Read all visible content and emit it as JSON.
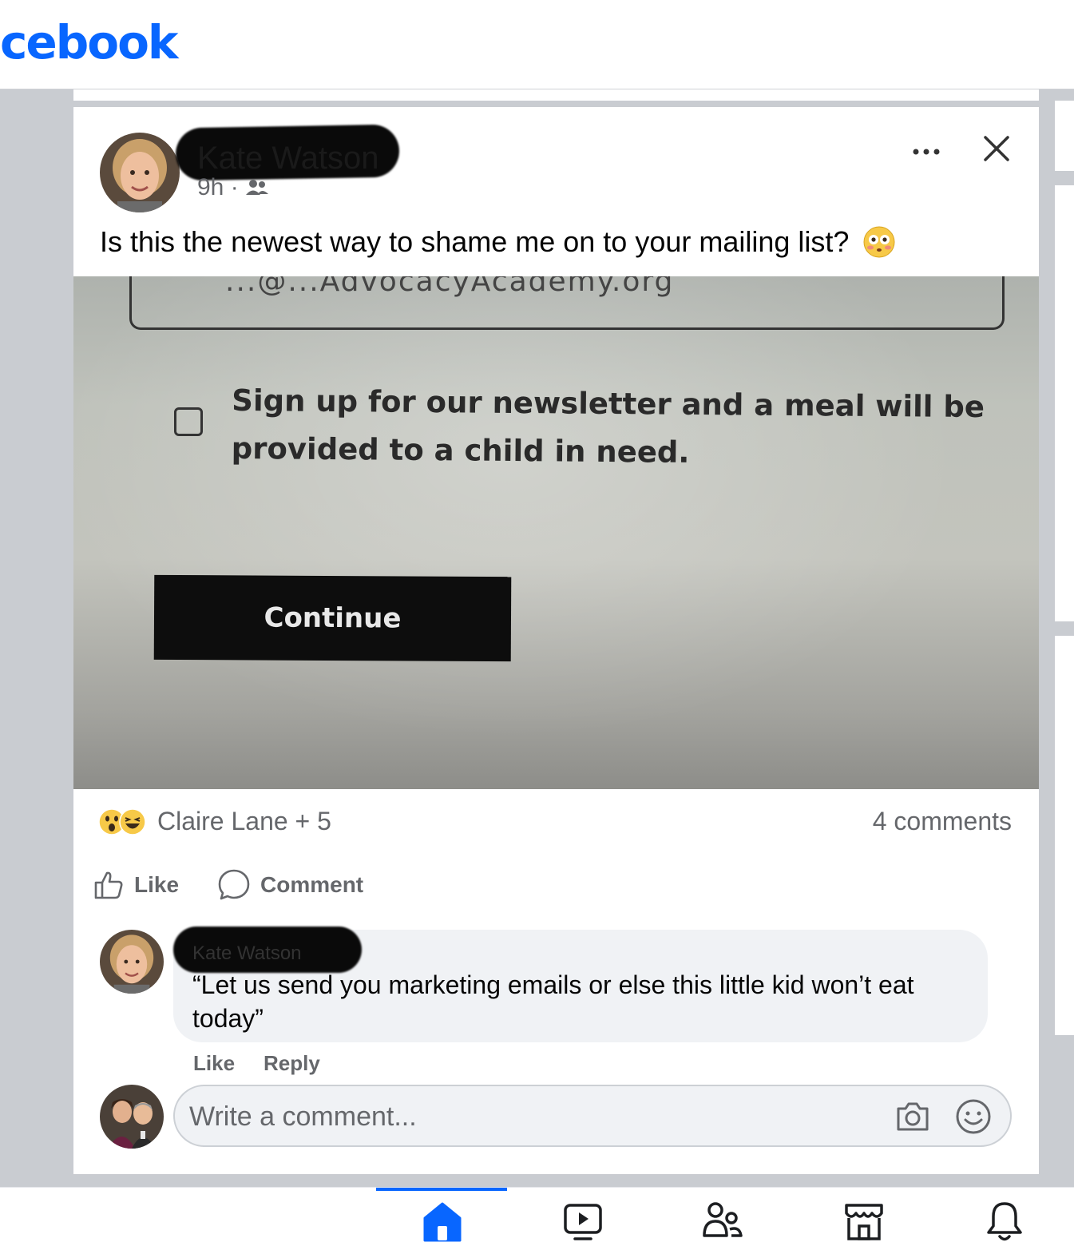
{
  "header": {
    "logo_text": "cebook"
  },
  "post": {
    "author_name": "Kate Watson",
    "time": "9h",
    "text": "Is this the newest way to shame me on to your mailing list?",
    "photo": {
      "email_fragment": "...@...AdvocacyAcademy.org",
      "newsletter_line1": "Sign up for our newsletter and a meal will be",
      "newsletter_line2": "provided to a child in need.",
      "continue_label": "Continue"
    },
    "reactions_text": "Claire Lane + 5",
    "comments_count": "4 comments",
    "like_label": "Like",
    "comment_label": "Comment"
  },
  "comment": {
    "author_name": "Kate Watson",
    "text": "“Let us send you marketing emails or else this little kid won’t eat today”",
    "like_label": "Like",
    "reply_label": "Reply"
  },
  "composer": {
    "placeholder": "Write a comment..."
  },
  "colors": {
    "brand": "#0866ff",
    "secondary_text": "#65676b",
    "bubble": "#f0f2f5"
  },
  "icons": [
    "more-icon",
    "close-icon",
    "flushed-emoji-icon",
    "wow-reaction-icon",
    "haha-reaction-icon",
    "thumbs-up-icon",
    "comment-bubble-icon",
    "camera-icon",
    "smiley-icon",
    "home-icon",
    "video-icon",
    "friends-icon",
    "marketplace-icon",
    "bell-icon"
  ]
}
